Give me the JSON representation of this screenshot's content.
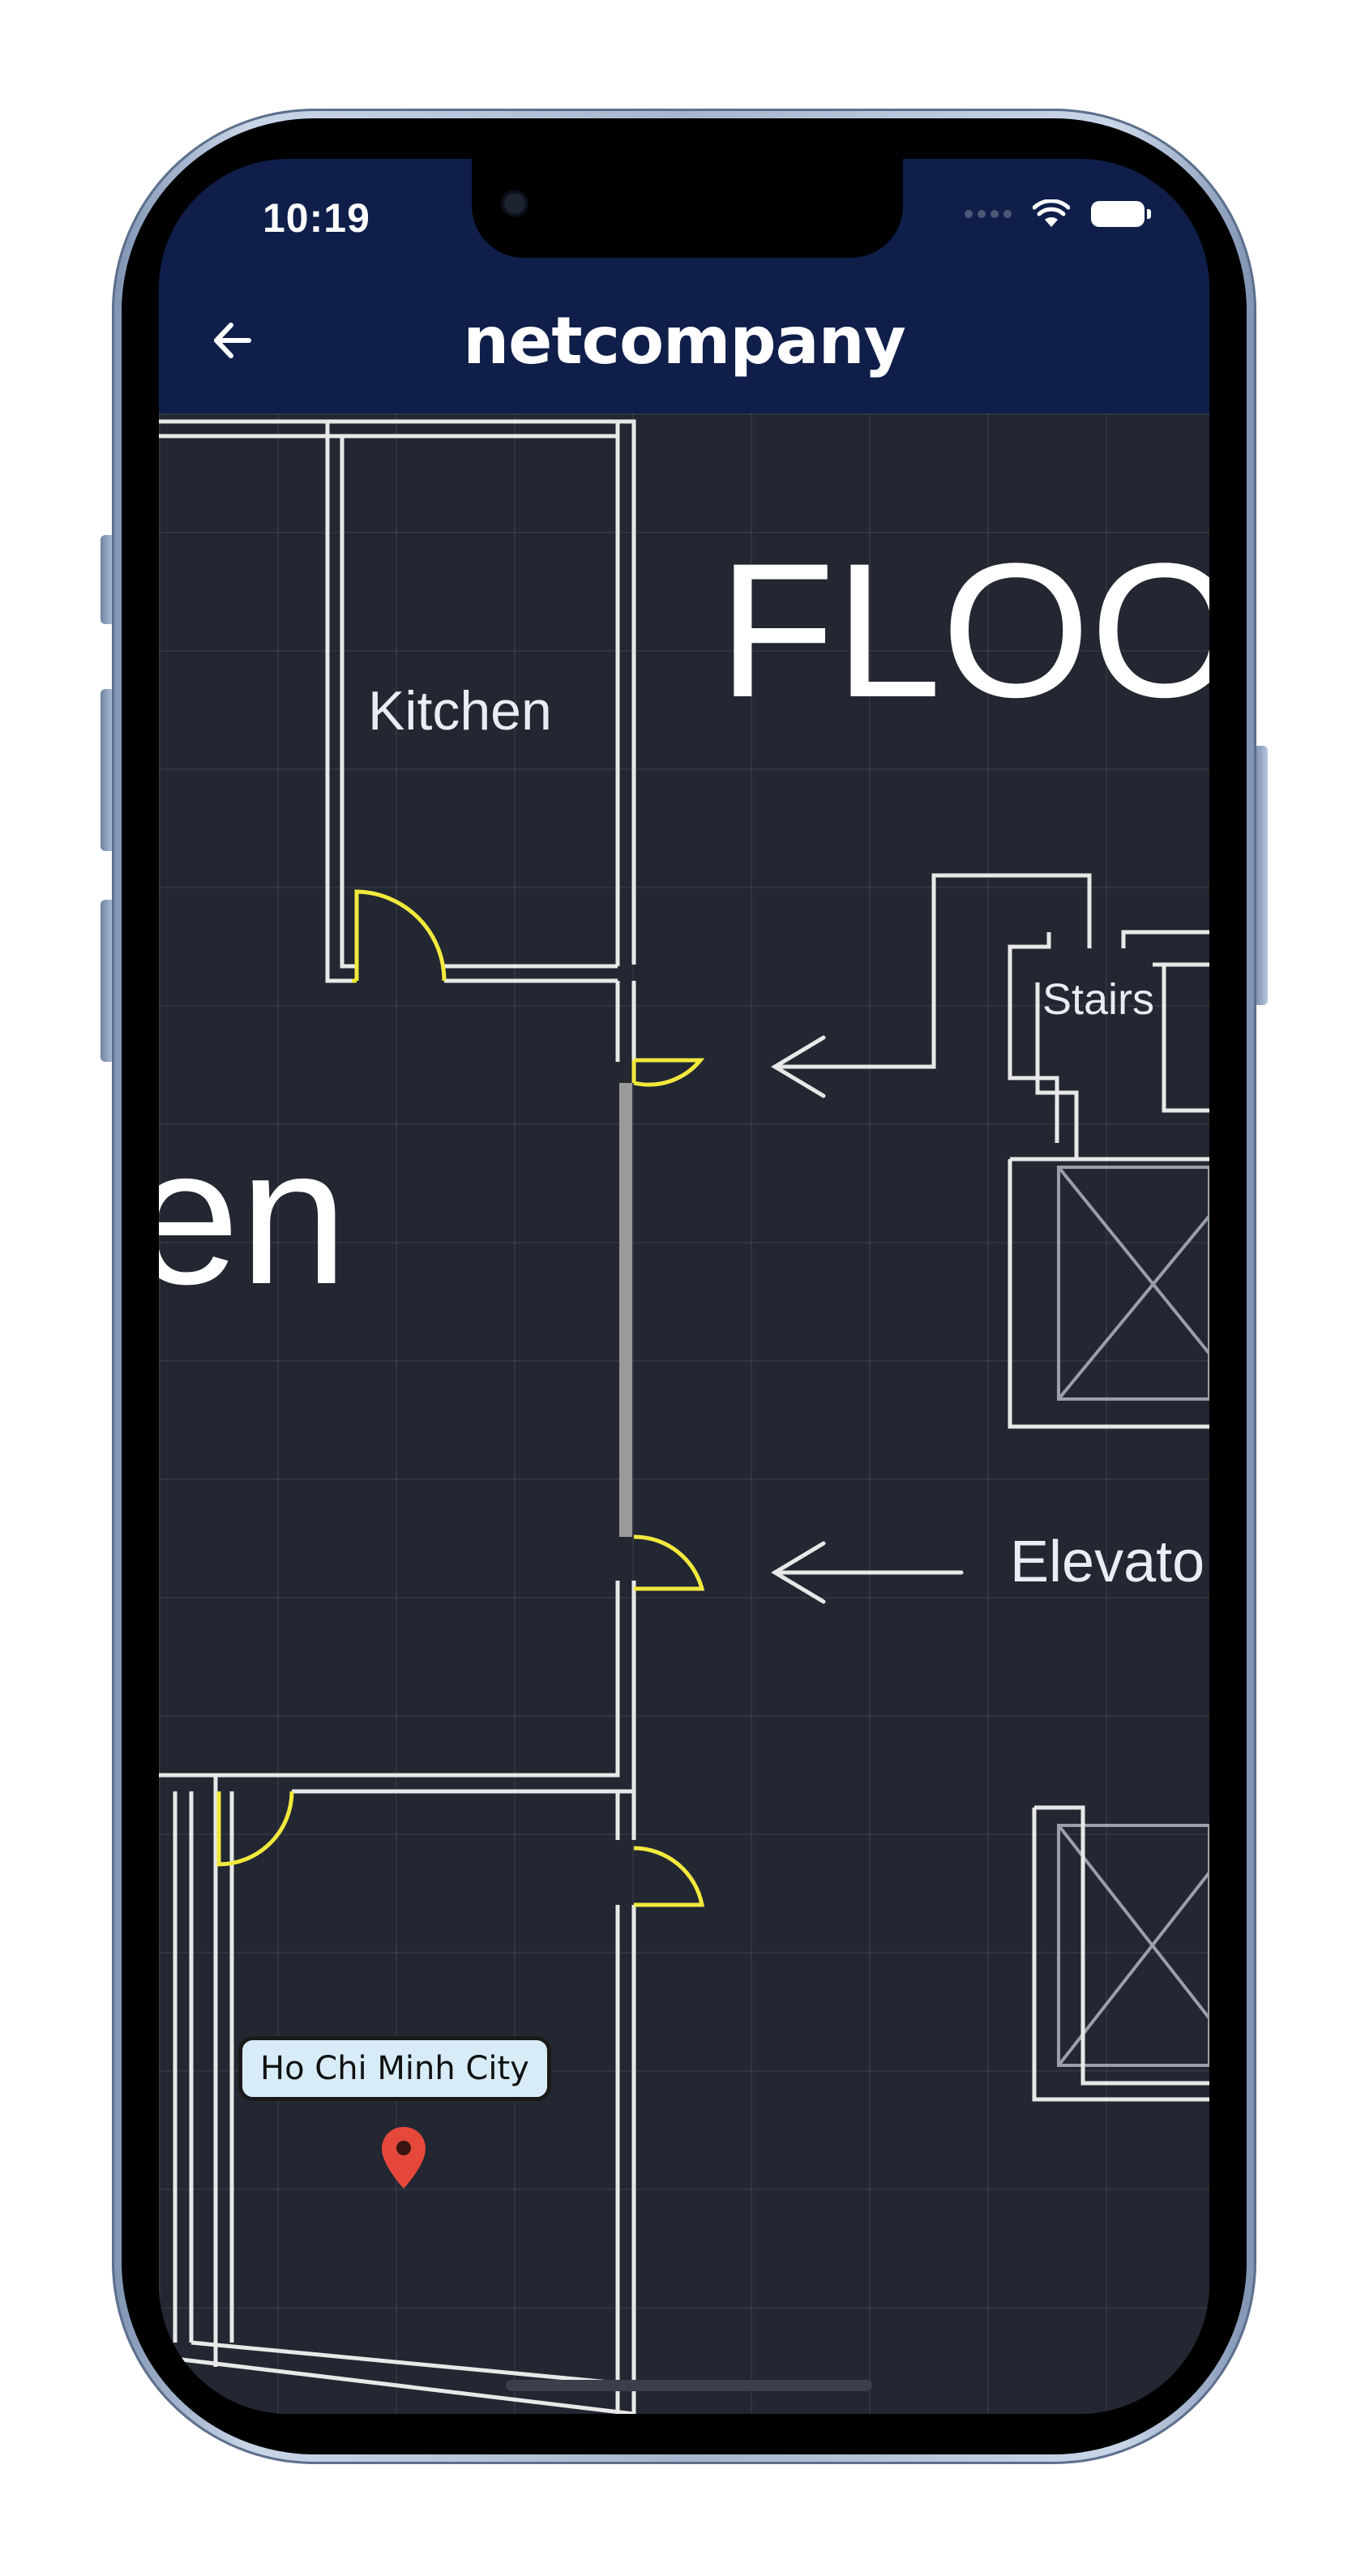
{
  "status_bar": {
    "time": "10:19"
  },
  "app_bar": {
    "title": "netcompany",
    "back_icon": "arrow-left-icon"
  },
  "floor_plan": {
    "labels": {
      "kitchen": "Kitchen",
      "floor_heading": "FLOO",
      "room_fragment": "en",
      "stairs": "Stairs",
      "elevator": "Elevato"
    }
  },
  "map_marker": {
    "label": "Ho Chi Minh City",
    "icon": "map-pin-icon",
    "color": "#e5483b"
  },
  "colors": {
    "app_bar_bg": "#0f1f4a",
    "plan_bg": "#222732",
    "wall": "#e8e8e8",
    "door": "#f2e93d"
  }
}
